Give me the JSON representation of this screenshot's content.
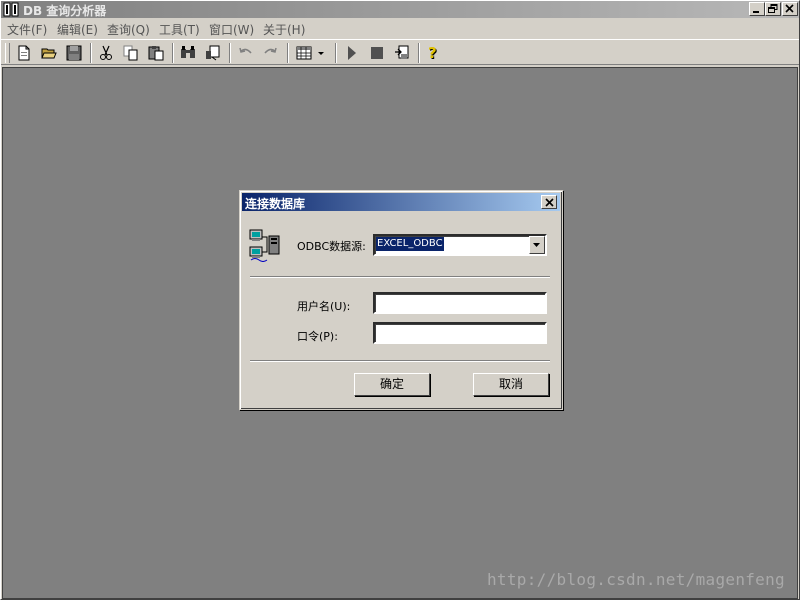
{
  "window": {
    "title": "DB 查询分析器",
    "min_label": "minimize",
    "restore_label": "restore",
    "close_label": "close"
  },
  "menu": [
    {
      "label": "文件(F)"
    },
    {
      "label": "编辑(E)"
    },
    {
      "label": "查询(Q)"
    },
    {
      "label": "工具(T)"
    },
    {
      "label": "窗口(W)"
    },
    {
      "label": "关于(H)"
    }
  ],
  "toolbar": {
    "icons": [
      "new-file-icon",
      "open-folder-icon",
      "save-icon",
      "cut-icon",
      "copy-icon",
      "paste-icon",
      "find-icon",
      "replace-icon",
      "undo-icon",
      "redo-icon",
      "grid-icon",
      "dropdown-arrow-icon",
      "run-icon",
      "stop-icon",
      "export-icon",
      "help-icon"
    ]
  },
  "dialog": {
    "title": "连接数据库",
    "dsn_label": "ODBC数据源:",
    "dsn_value": "EXCEL_ODBC",
    "username_label": "用户名(U):",
    "username_value": "",
    "password_label": "口令(P):",
    "password_value": "",
    "ok_label": "确定",
    "cancel_label": "取消"
  },
  "watermark": "http://blog.csdn.net/magenfeng",
  "colors": {
    "face": "#d4d0c8",
    "client": "#808080",
    "dialog_title_start": "#0a246a",
    "dialog_title_end": "#a6caf0",
    "selection": "#0a246a"
  }
}
